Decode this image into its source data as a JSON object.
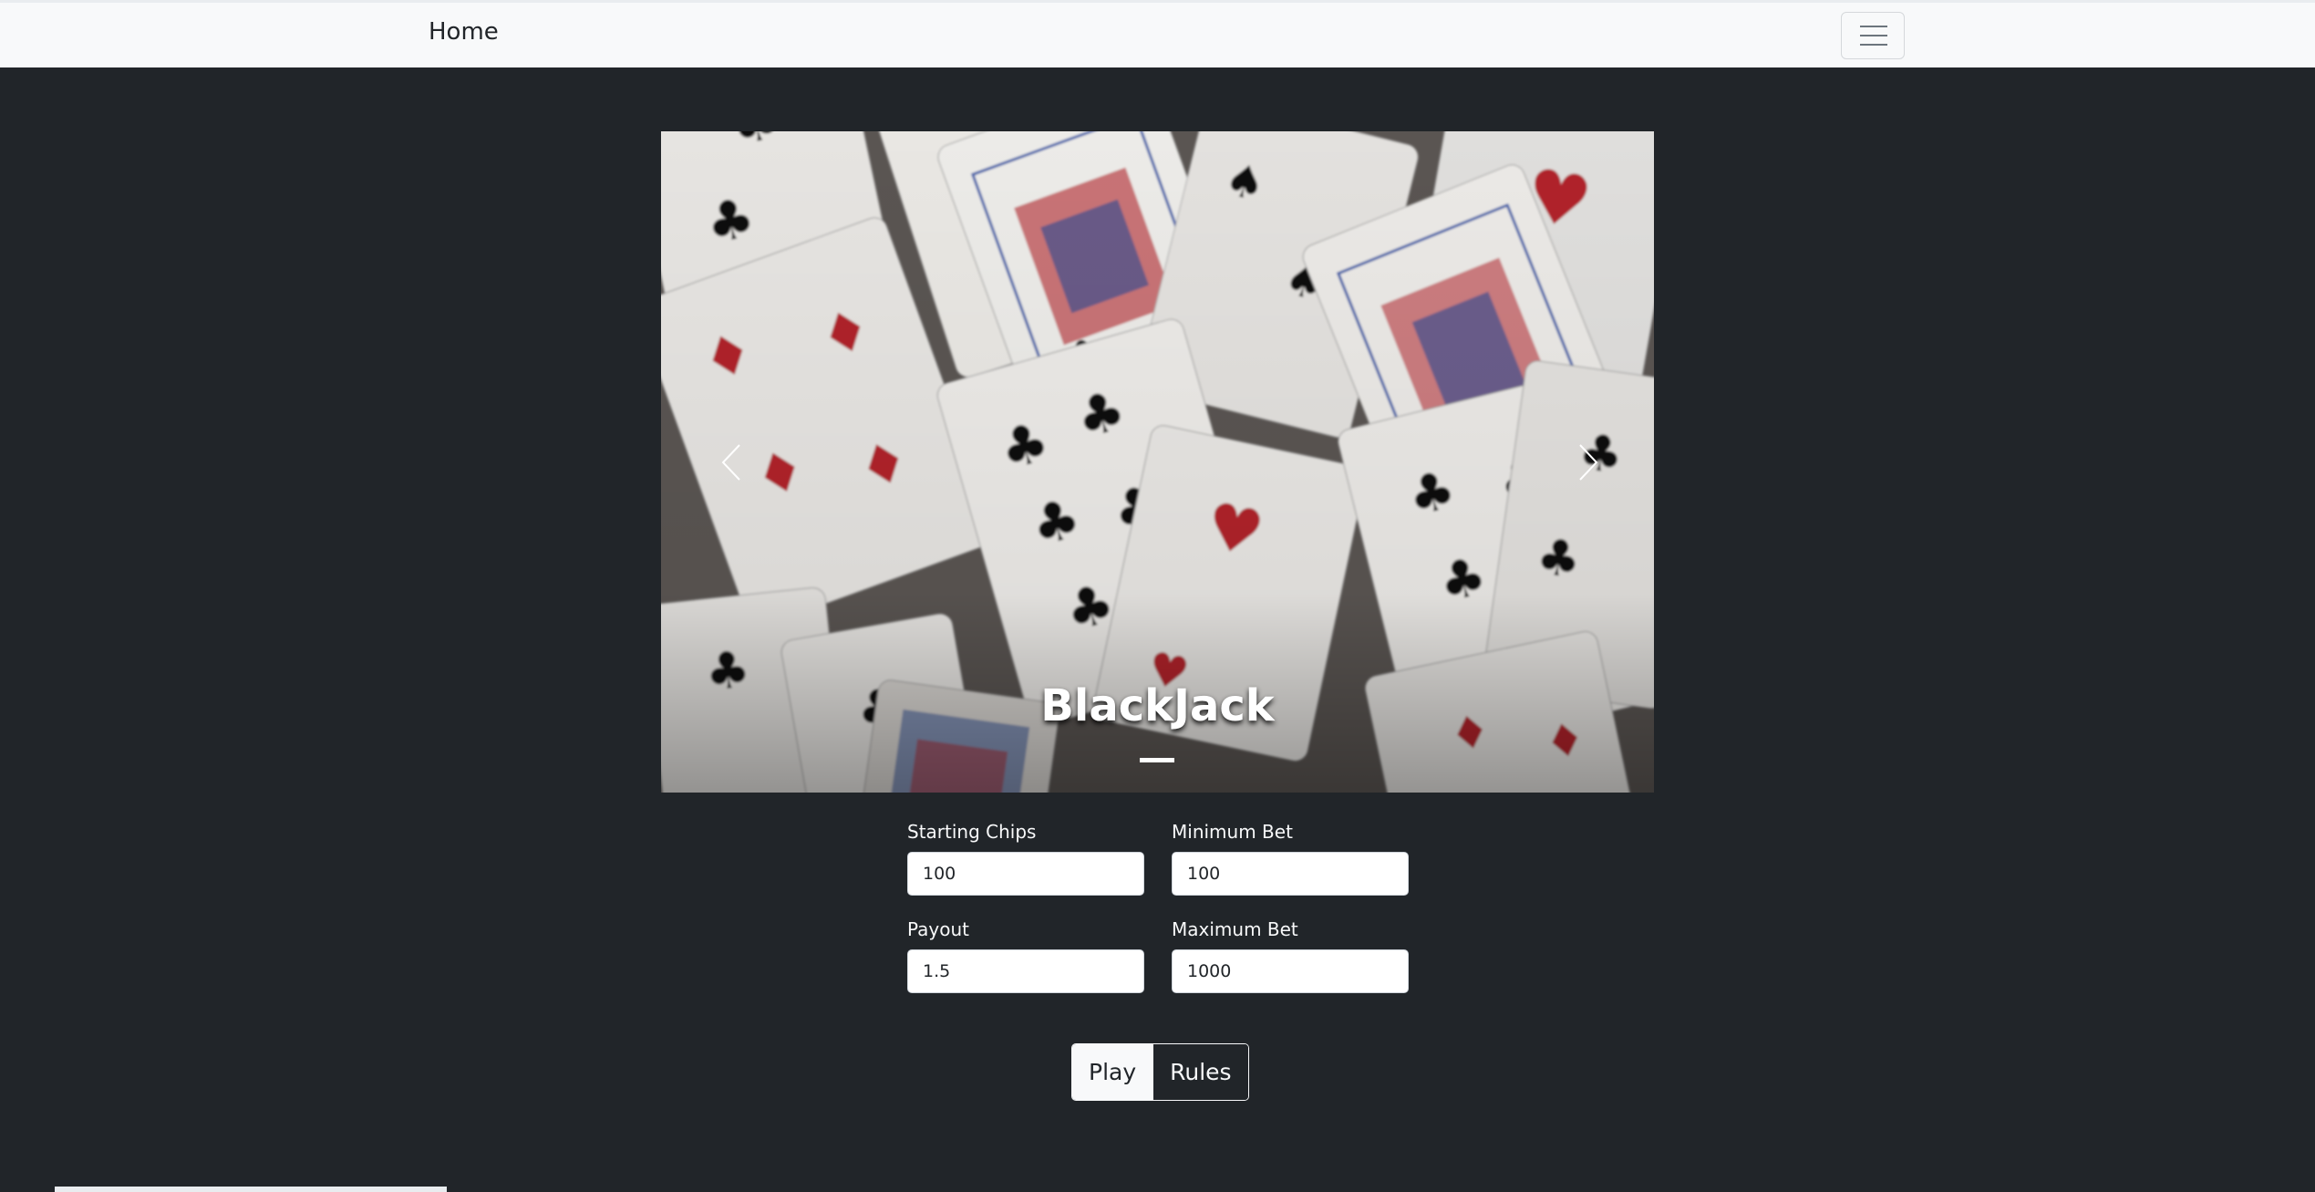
{
  "navbar": {
    "brand": "Home",
    "toggler_icon": "hamburger-icon"
  },
  "carousel": {
    "caption": "BlackJack",
    "prev_icon": "chevron-left-icon",
    "next_icon": "chevron-right-icon",
    "indicators": 1,
    "active_indicator": 0
  },
  "settings": {
    "starting_chips": {
      "label": "Starting Chips",
      "value": "100"
    },
    "minimum_bet": {
      "label": "Minimum Bet",
      "value": "100"
    },
    "payout": {
      "label": "Payout",
      "value": "1.5"
    },
    "maximum_bet": {
      "label": "Maximum Bet",
      "value": "1000"
    }
  },
  "actions": {
    "play_label": "Play",
    "rules_label": "Rules"
  },
  "colors": {
    "page_bg": "#212529",
    "navbar_bg": "#f8f9fa",
    "card_red": "#b0232a",
    "card_black": "#111111"
  }
}
